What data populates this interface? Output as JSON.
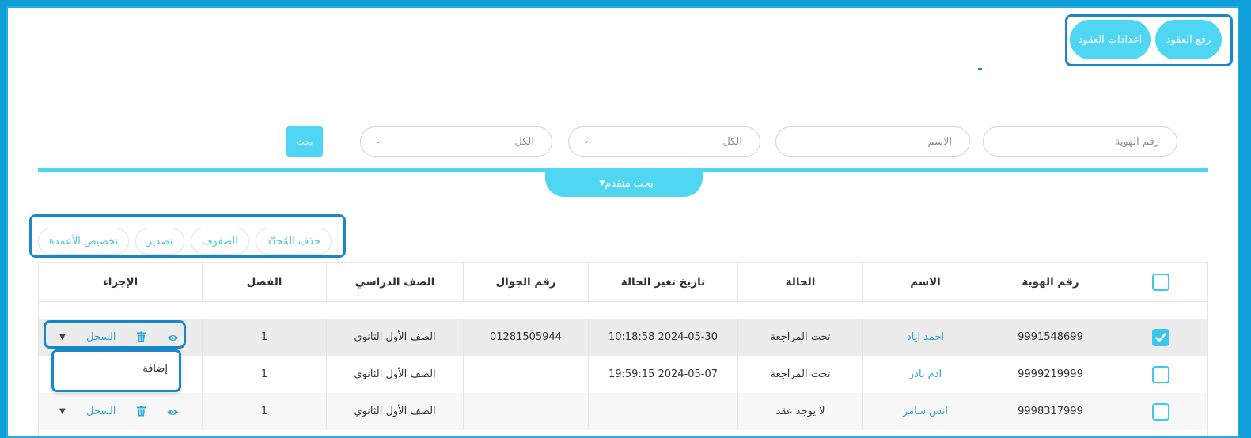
{
  "header": {
    "upload_contracts": "رفع العقود",
    "contract_settings": "اعدادات العقود"
  },
  "filters": {
    "id_placeholder": "رقم الهوية",
    "name_placeholder": "الاسم",
    "select1_value": "الكل",
    "select2_value": "الكل",
    "search_button": "بحث",
    "advanced_search": "بحث متقدم"
  },
  "toolbar": {
    "delete_selected": "حذف المُحدّد",
    "rows": "الصفوف",
    "export": "تصدير",
    "customize_columns": "تخصيص الأعمدة"
  },
  "table": {
    "headers": {
      "id": "رقم الهوية",
      "name": "الاسم",
      "status": "الحالة",
      "status_date": "تاريخ تغير الحالة",
      "mobile": "رقم الجوال",
      "grade": "الصف الدراسي",
      "class": "الفصل",
      "action": "الإجراء"
    },
    "rows": [
      {
        "checked": true,
        "id": "9991548699",
        "name": "احمد اياد",
        "status": "تحت المراجعة",
        "status_date": "2024-05-30 10:18:58",
        "mobile": "01281505944",
        "grade": "الصف الأول الثانوي",
        "class": "1",
        "log": "السجل"
      },
      {
        "checked": false,
        "id": "9999219999",
        "name": "ادم نادر",
        "status": "تحت المراجعة",
        "status_date": "2024-05-07 19:59:15",
        "mobile": "",
        "grade": "الصف الأول الثانوي",
        "class": "1",
        "log": "السجل"
      },
      {
        "checked": false,
        "id": "9998317999",
        "name": "انس سامر",
        "status": "لا يوجد عقد",
        "status_date": "",
        "mobile": "",
        "grade": "الصف الأول الثانوي",
        "class": "1",
        "log": "السجل"
      }
    ]
  },
  "dropdown_menu": {
    "add": "إضافة"
  },
  "colors": {
    "accent": "#4fd6f3",
    "link": "#2fa5d8",
    "highlight_border": "#1b86c8"
  }
}
